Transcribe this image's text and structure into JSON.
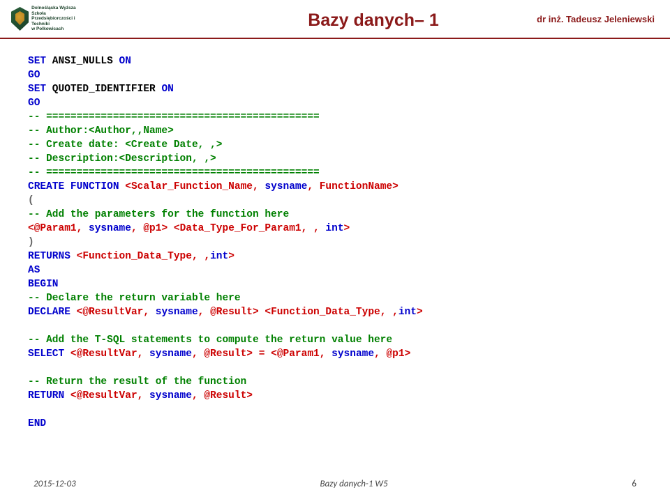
{
  "header": {
    "logo_text": "Dolnośląska Wyższa Szkoła\nPrzedsiębiorczości i Techniki\nw Polkowicach",
    "title": "Bazy danych– 1",
    "author": "dr inż. Tadeusz Jeleniewski"
  },
  "code": {
    "line1_a": "SET",
    "line1_b": " ANSI_NULLS ",
    "line1_c": "ON",
    "line2": "GO",
    "line3_a": "SET",
    "line3_b": " QUOTED_IDENTIFIER ",
    "line3_c": "ON",
    "line4": "GO",
    "line5": "-- =============================================",
    "line6": "-- Author:<Author,,Name>",
    "line7": "-- Create date: <Create Date, ,>",
    "line8": "-- Description:<Description, ,>",
    "line9": "-- =============================================",
    "line10_a": "CREATE",
    "line10_b": " FUNCTION",
    "line10_c": " <",
    "line10_d": "Scalar_Function_Name",
    "line10_e": ", ",
    "line10_f": "sysname",
    "line10_g": ", ",
    "line10_h": "FunctionName",
    "line10_i": ">",
    "line11": "(",
    "line12": "-- Add the parameters for the function here",
    "line13_a": "<",
    "line13_b": "@Param1",
    "line13_c": ", ",
    "line13_d": "sysname",
    "line13_e": ", ",
    "line13_f": "@p1",
    "line13_g": "> <",
    "line13_h": "Data_Type_For_Param1",
    "line13_i": ", , ",
    "line13_j": "int",
    "line13_k": ">",
    "line14": ")",
    "line15_a": "RETURNS",
    "line15_b": " <",
    "line15_c": "Function_Data_Type",
    "line15_d": ", ,",
    "line15_e": "int",
    "line15_f": ">",
    "line16": "AS",
    "line17": "BEGIN",
    "line18": "-- Declare the return variable here",
    "line19_a": "DECLARE",
    "line19_b": " <",
    "line19_c": "@ResultVar",
    "line19_d": ", ",
    "line19_e": "sysname",
    "line19_f": ", ",
    "line19_g": "@Result",
    "line19_h": "> <",
    "line19_i": "Function_Data_Type",
    "line19_j": ", ,",
    "line19_k": "int",
    "line19_l": ">",
    "line20": "",
    "line21": "-- Add the T-SQL statements to compute the return value here",
    "line22_a": "SELECT",
    "line22_b": " <",
    "line22_c": "@ResultVar",
    "line22_d": ", ",
    "line22_e": "sysname",
    "line22_f": ", ",
    "line22_g": "@Result",
    "line22_h": "> = <",
    "line22_i": "@Param1",
    "line22_j": ", ",
    "line22_k": "sysname",
    "line22_l": ", ",
    "line22_m": "@p1",
    "line22_n": ">",
    "line23": "",
    "line24": "-- Return the result of the function",
    "line25_a": "RETURN",
    "line25_b": " <",
    "line25_c": "@ResultVar",
    "line25_d": ", ",
    "line25_e": "sysname",
    "line25_f": ", ",
    "line25_g": "@Result",
    "line25_h": ">",
    "line26": "",
    "line27": "END"
  },
  "footer": {
    "date": "2015-12-03",
    "center": "Bazy danych-1 W5",
    "page": "6"
  }
}
